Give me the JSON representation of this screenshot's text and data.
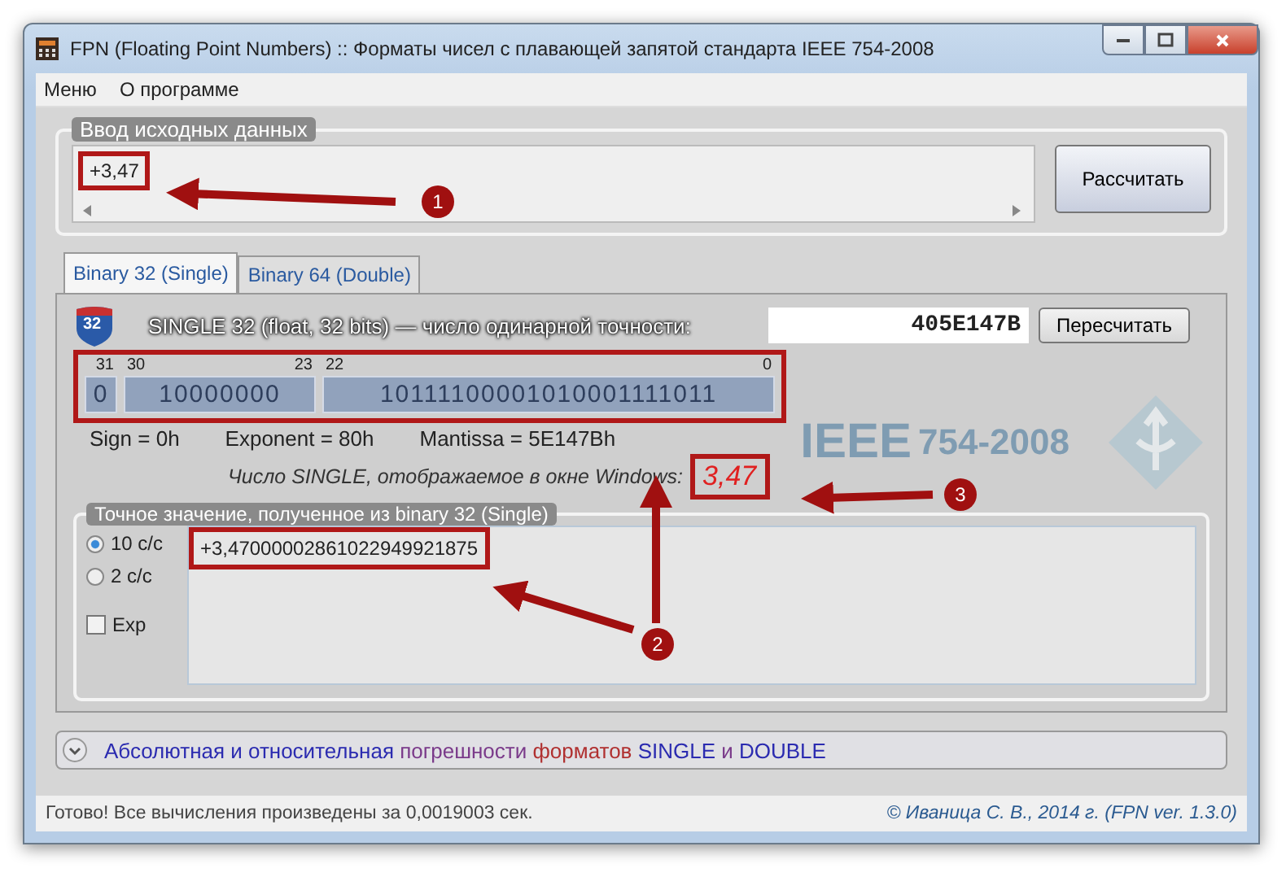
{
  "window": {
    "title": "FPN (Floating Point Numbers) :: Форматы чисел с плавающей запятой стандарта IEEE 754-2008"
  },
  "menu": [
    {
      "label": "Меню"
    },
    {
      "label": "О программе"
    }
  ],
  "input_group": {
    "title": "Ввод исходных данных",
    "value": "+3,47",
    "highlighted": true,
    "button": "Рассчитать"
  },
  "tabs": [
    {
      "label": "Binary 32 (Single)",
      "selected": true
    },
    {
      "label": "Binary 64 (Double)",
      "selected": false
    }
  ],
  "format": {
    "badge": "32",
    "heading": "SINGLE  32 (float, 32 bits) — число одинарной точности:",
    "hex": "405E147B",
    "recalc_button": "Пересчитать",
    "bits_highlighted": true,
    "bit_fields": [
      {
        "hi": "31",
        "value": "0"
      },
      {
        "hi": "30",
        "lo": "23",
        "value": "10000000"
      },
      {
        "hi": "22",
        "lo": "0",
        "value": "10111100001010001111011"
      }
    ],
    "parts": [
      "Sign = 0h",
      "Exponent = 80h",
      "Mantissa = 5E147Bh"
    ],
    "windows_label": "Число SINGLE, отображаемое в окне Windows:",
    "windows_value": "3,47",
    "windows_highlighted": true,
    "logo": {
      "word": "IEEE",
      "number": "754-2008"
    }
  },
  "exact_group": {
    "title": "Точное значение, полученное из binary 32 (Single)",
    "radios": [
      {
        "label": "10 с/с",
        "selected": true
      },
      {
        "label": "2 с/с",
        "selected": false
      }
    ],
    "exp": {
      "label": "Exp",
      "checked": false
    },
    "value": "+3,47000002861022949921875",
    "highlighted": true
  },
  "expander": {
    "expanded": false,
    "segments": [
      {
        "text": "Абсолютная и относительная ",
        "color": "#2b2bb0"
      },
      {
        "text": "погрешности ",
        "color": "#7a3a8a"
      },
      {
        "text": "форматов ",
        "color": "#b03030"
      },
      {
        "text": "SINGLE ",
        "color": "#2b2bb0"
      },
      {
        "text": "и ",
        "color": "#7a3a8a"
      },
      {
        "text": "DOUBLE",
        "color": "#2b2bb0"
      }
    ]
  },
  "status_bar": {
    "message": "Готово! Все вычисления произведены за 0,0019003 сек.",
    "copyright": "© Иваница С. В., 2014 г. (FPN ver. 1.3.0)"
  },
  "annotations": [
    {
      "number": "1"
    },
    {
      "number": "2"
    },
    {
      "number": "3"
    }
  ]
}
